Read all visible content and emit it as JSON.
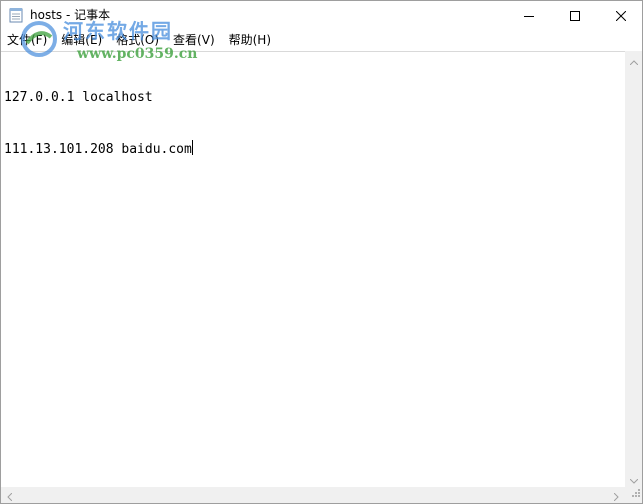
{
  "window": {
    "title": "hosts - 记事本"
  },
  "menu": [
    {
      "label": "文件(F)",
      "name": "menu-file"
    },
    {
      "label": "编辑(E)",
      "name": "menu-edit"
    },
    {
      "label": "格式(O)",
      "name": "menu-format"
    },
    {
      "label": "查看(V)",
      "name": "menu-view"
    },
    {
      "label": "帮助(H)",
      "name": "menu-help"
    }
  ],
  "editor": {
    "lines": [
      "127.0.0.1 localhost",
      "111.13.101.208 baidu.com"
    ]
  },
  "watermark": {
    "site_name": "河东软件园",
    "url": "www.pc0359.cn"
  },
  "icons": {
    "app": "notepad-icon",
    "minimize": "minimize-icon",
    "maximize": "maximize-icon",
    "close": "close-icon"
  },
  "colors": {
    "background": "#ffffff",
    "scrollbar": "#f0f0f0",
    "text": "#000000"
  }
}
